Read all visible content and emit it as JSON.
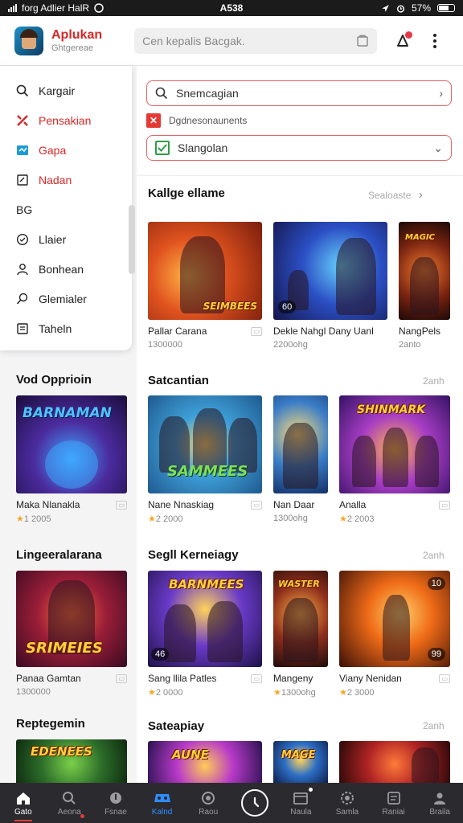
{
  "status_bar": {
    "left": "forg Adlier HalR",
    "center": "A538",
    "right": "57%"
  },
  "header": {
    "app_name": "Aplukan",
    "app_subtitle": "Ghtgereae",
    "search_placeholder": "Cen kepalis Bacgak."
  },
  "side_menu": {
    "items": [
      {
        "label": "Kargair",
        "icon": "search-icon",
        "highlight": false
      },
      {
        "label": "Pensakian",
        "icon": "tools-icon",
        "highlight": true
      },
      {
        "label": "Gapa",
        "icon": "gamepad-icon",
        "highlight": true
      },
      {
        "label": "Nadan",
        "icon": "edit-icon",
        "highlight": true
      },
      {
        "label": "BG",
        "icon": "",
        "highlight": false
      },
      {
        "label": "Llaier",
        "icon": "chat-icon",
        "highlight": false
      },
      {
        "label": "Bonhean",
        "icon": "user-icon",
        "highlight": false
      },
      {
        "label": "Glemialer",
        "icon": "search-person-icon",
        "highlight": false
      },
      {
        "label": "Taheln",
        "icon": "list-icon",
        "highlight": false
      }
    ]
  },
  "filters": {
    "search_value": "Snemcagian",
    "checkbox_label": "Dgdnesonaunents",
    "select_value": "Slangolan"
  },
  "sections": [
    {
      "title": "Kallge ellame",
      "see_all": "Sealoaste"
    },
    {
      "title": "Vod Opprioin"
    },
    {
      "title": "Satcantian",
      "see_all": "2anh"
    },
    {
      "title": "Lingeeralarana"
    },
    {
      "title": "Segll Kerneiagy",
      "see_all": "2anh"
    },
    {
      "title": "Reptegemin"
    },
    {
      "title": "Sateapiay",
      "see_all": "2anh"
    }
  ],
  "cards": [
    {
      "title": "Pallar Carana",
      "meta": "1300000",
      "rated": false,
      "art": "SEIMBEES"
    },
    {
      "title": "Dekle Nahgl Dany Uanl",
      "meta": "2200ohg",
      "rated": false,
      "art": ""
    },
    {
      "title": "NangPels",
      "meta": "2anto",
      "rated": false,
      "art": "MAGIC"
    },
    {
      "title": "Maka Nlanakla",
      "meta": "1 2005",
      "rated": true,
      "art": "BARNAMAN"
    },
    {
      "title": "Nane Nnaskiag",
      "meta": "2 2000",
      "rated": true,
      "art": "SAMMEES"
    },
    {
      "title": "Nan Daar",
      "meta": "1300ohg",
      "rated": false,
      "art": ""
    },
    {
      "title": "Analla",
      "meta": "2 2003",
      "rated": true,
      "art": "SHINMARK"
    },
    {
      "title": "Panaa Gamtan",
      "meta": "1300000",
      "rated": false,
      "art": "SRIMEIES"
    },
    {
      "title": "Sang llila Patles",
      "meta": "2 0000",
      "rated": true,
      "art": "BARNMEES"
    },
    {
      "title": "Mangeny",
      "meta": "1300ohg",
      "rated": true,
      "art": "WASTER"
    },
    {
      "title": "Viany Nenidan",
      "meta": "2 3000",
      "rated": true,
      "art": ""
    },
    {
      "title": "",
      "meta": "",
      "rated": false,
      "art": "EDENEES"
    },
    {
      "title": "",
      "meta": "",
      "rated": false,
      "art": "AUNE"
    },
    {
      "title": "",
      "meta": "",
      "rated": false,
      "art": "MAGE"
    },
    {
      "title": "",
      "meta": "",
      "rated": false,
      "art": ""
    }
  ],
  "badges": [
    "60",
    "46",
    "10",
    "99"
  ],
  "bottom_nav": [
    {
      "label": "Gato",
      "icon": "home-icon"
    },
    {
      "label": "Aeona",
      "icon": "search-icon"
    },
    {
      "label": "Fsnae",
      "icon": "download-icon"
    },
    {
      "label": "Kalnd",
      "icon": "gamepad-icon"
    },
    {
      "label": "Raou",
      "icon": "globe-icon"
    },
    {
      "label": "",
      "icon": "compass-icon"
    },
    {
      "label": "Naula",
      "icon": "library-icon"
    },
    {
      "label": "Samla",
      "icon": "settings-icon"
    },
    {
      "label": "Raniai",
      "icon": "document-icon"
    },
    {
      "label": "Braila",
      "icon": "profile-icon"
    }
  ],
  "colors": {
    "accent": "#d62828",
    "nav_bg": "#2b2b2f",
    "nav_active_blue": "#2f8cff",
    "star": "#f5a623"
  }
}
